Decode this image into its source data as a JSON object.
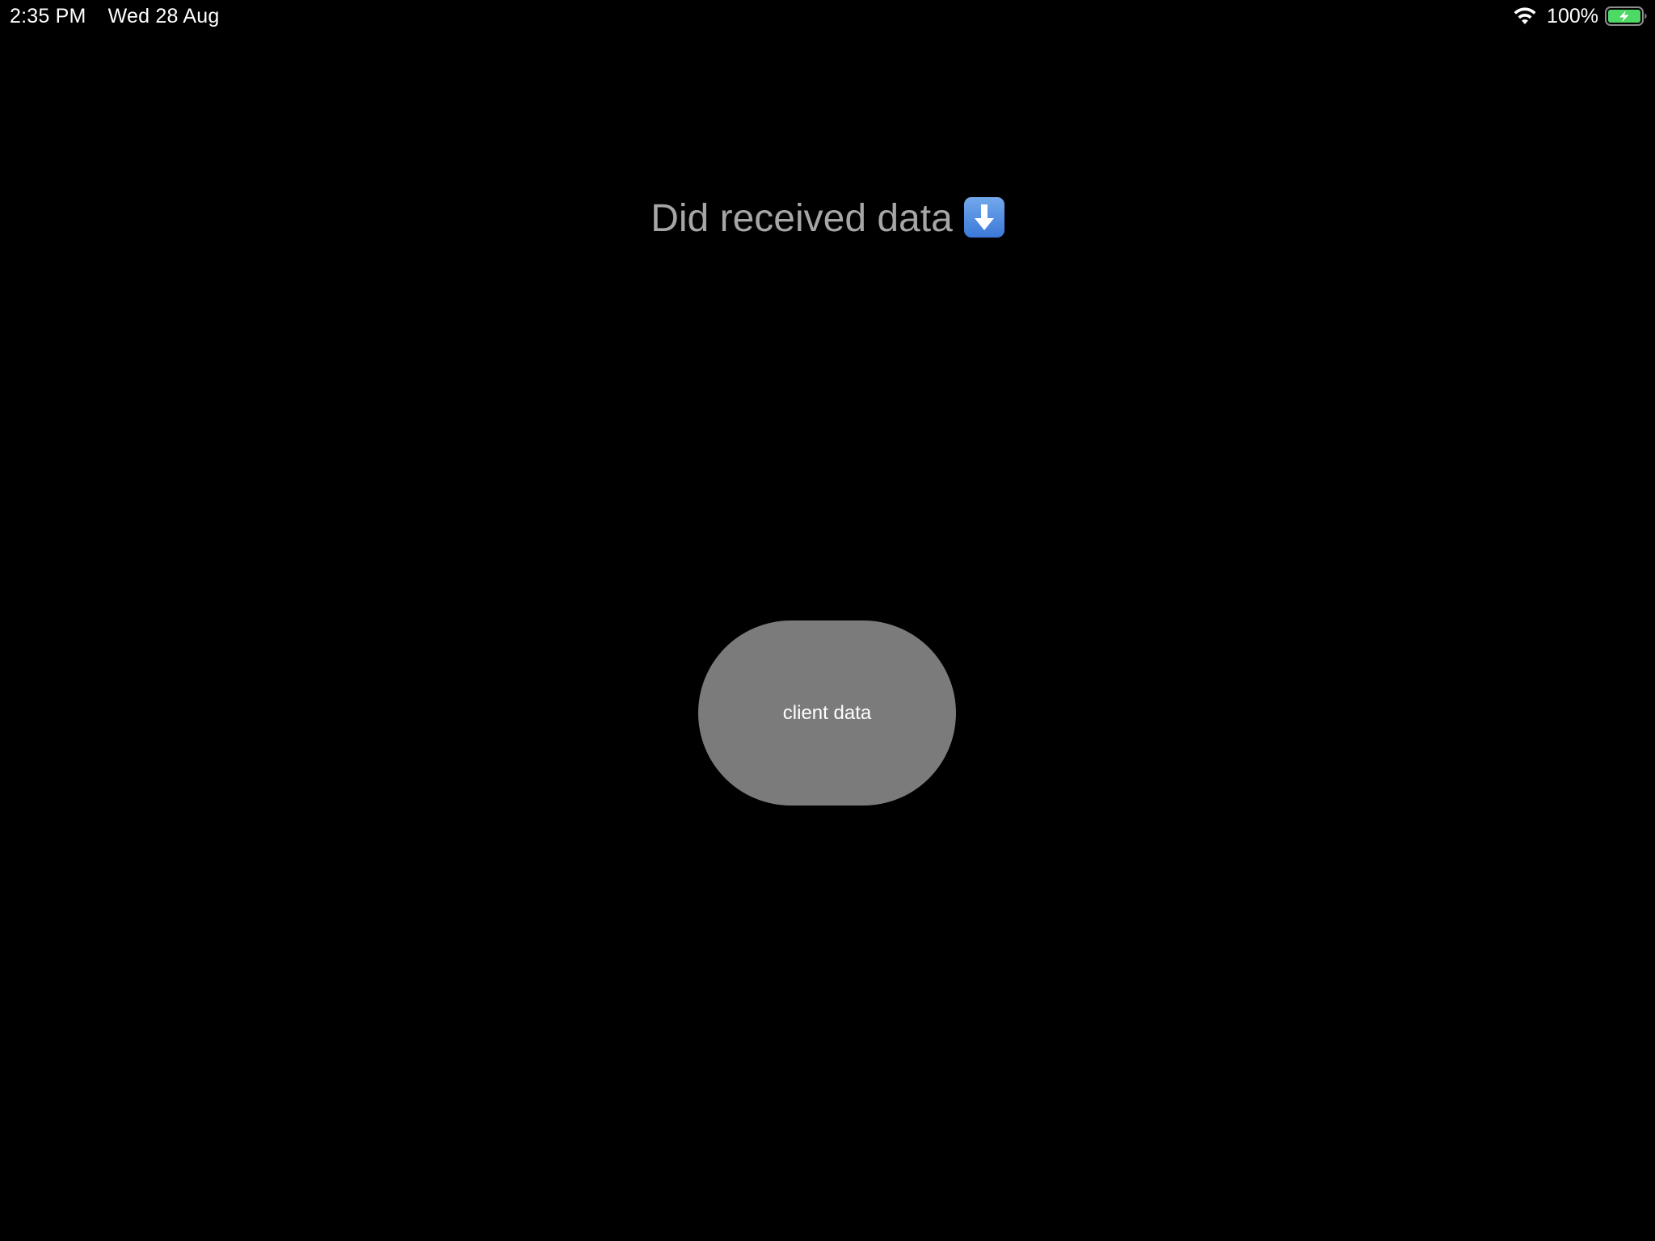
{
  "status_bar": {
    "time": "2:35 PM",
    "date": "Wed 28 Aug",
    "battery_percent": "100%",
    "wifi_icon": "wifi-icon",
    "battery_icon": "battery-charging-icon",
    "battery_color": "#4cd964"
  },
  "main": {
    "title": "Did received data",
    "title_icon": "down-arrow-emoji-icon",
    "title_color": "#a6a6a6",
    "button_label": "client data",
    "button_color": "#7b7b7b"
  }
}
